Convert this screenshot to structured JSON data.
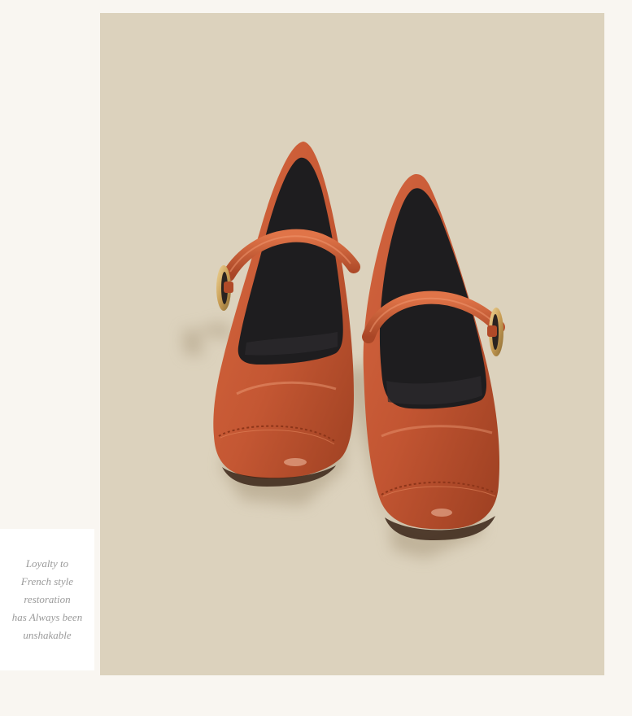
{
  "caption": {
    "lines": [
      "Loyalty to",
      "French style",
      "restoration",
      "has Always been",
      "unshakable"
    ]
  },
  "colors": {
    "page_background": "#f9f6f1",
    "photo_background": "#dcd2bd",
    "shoe_leather": "#c65a35",
    "shoe_lining": "#1e1d1f",
    "buckle": "#d6b06a",
    "caption_text": "#9a9a9a"
  }
}
